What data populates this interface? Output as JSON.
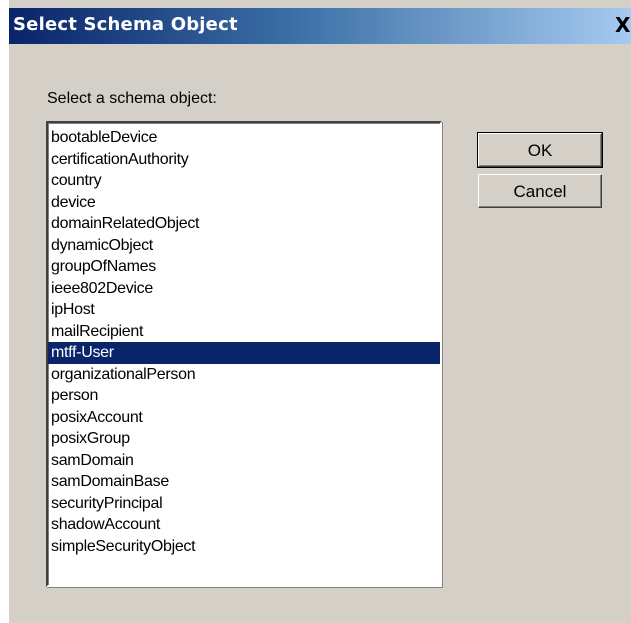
{
  "dialog": {
    "title": "Select Schema Object",
    "close_label": "X",
    "prompt": "Select a schema object:",
    "ok_label": "OK",
    "cancel_label": "Cancel"
  },
  "list": {
    "items": [
      "bootableDevice",
      "certificationAuthority",
      "country",
      "device",
      "domainRelatedObject",
      "dynamicObject",
      "groupOfNames",
      "ieee802Device",
      "ipHost",
      "mailRecipient",
      "mtff-User",
      "organizationalPerson",
      "person",
      "posixAccount",
      "posixGroup",
      "samDomain",
      "samDomainBase",
      "securityPrincipal",
      "shadowAccount",
      "simpleSecurityObject"
    ],
    "selected": "mtff-User"
  }
}
